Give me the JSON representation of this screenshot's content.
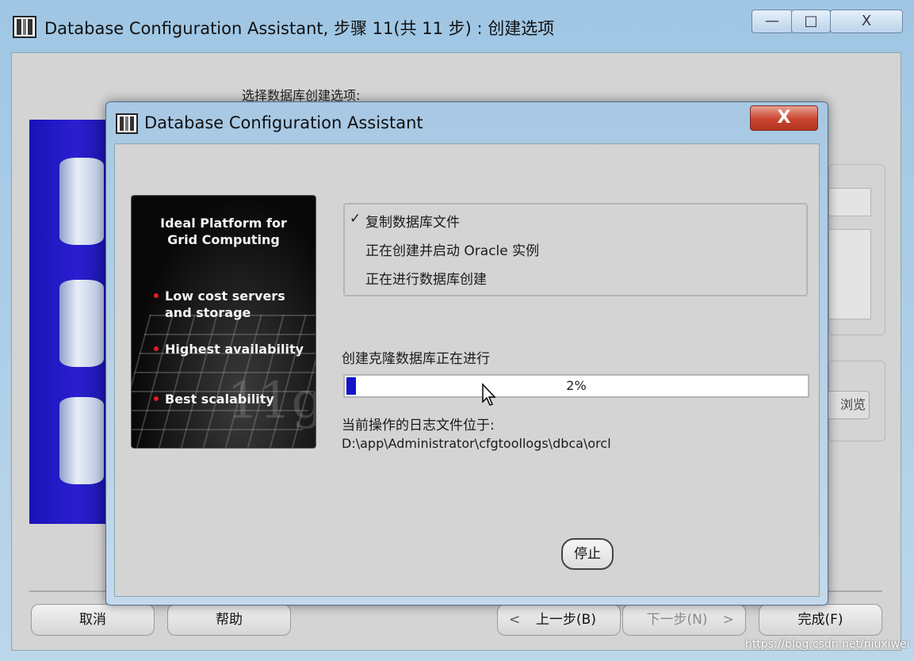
{
  "outer_window": {
    "title": "Database Configuration Assistant, 步骤 11(共 11 步) : 创建选项",
    "controls": {
      "minimize": "—",
      "maximize": "□",
      "close": "X"
    },
    "section_label": "选择数据库创建选项:",
    "browse_label": "浏览",
    "nav": {
      "cancel": "取消",
      "help": "帮助",
      "back": "上一步(B)",
      "next": "下一步(N)",
      "finish": "完成(F)"
    }
  },
  "dialog": {
    "title": "Database Configuration Assistant",
    "close": "X",
    "promo": {
      "heading_line1": "Ideal Platform for",
      "heading_line2": "Grid Computing",
      "bullet1_line1": "Low cost servers",
      "bullet1_line2": "and storage",
      "bullet2": "Highest availability",
      "bullet3": "Best scalability",
      "logo_text": "11g"
    },
    "steps": [
      {
        "label": "复制数据库文件",
        "done": true,
        "check": "✓"
      },
      {
        "label": "正在创建并启动 Oracle 实例",
        "done": false
      },
      {
        "label": "正在进行数据库创建",
        "done": false
      }
    ],
    "progress": {
      "label": "创建克隆数据库正在进行",
      "percent": 2,
      "text": "2%",
      "color": "#1414c8"
    },
    "log": {
      "label": "当前操作的日志文件位于:",
      "path": "D:\\app\\Administrator\\cfgtoollogs\\dbca\\orcl"
    },
    "stop_button": "停止"
  },
  "watermark": "https://blog.csdn.net/niuxiwei"
}
